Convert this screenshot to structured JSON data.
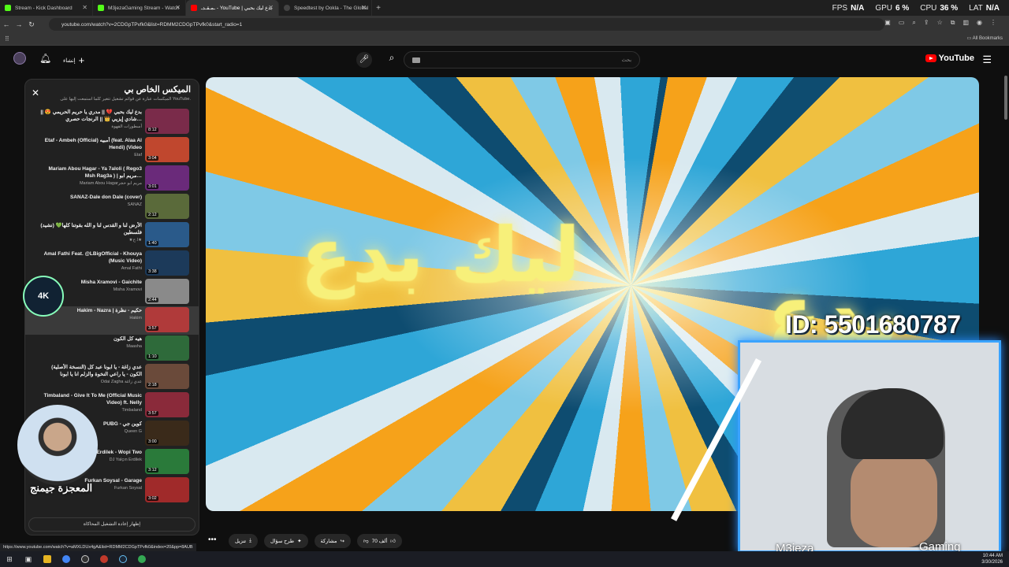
{
  "browser": {
    "tabs": [
      {
        "label": "Stream - Kick Dashboard",
        "color": "#53fc18",
        "active": false
      },
      {
        "label": "M3jezaGaming Stream - Watch",
        "color": "#53fc18",
        "active": false
      },
      {
        "label": "ـمـقـدـ - YouTube | بدع ليك بحبي",
        "color": "#ff0000",
        "active": true
      },
      {
        "label": "Speedtest by Ookla - The Global",
        "color": "#888888",
        "active": false
      }
    ],
    "url": "youtube.com/watch?v=2CDGpTPvfk0&list=RDMM2CDGpTPvfk0&start_radio=1",
    "all_bookmarks": "All Bookmarks",
    "status_url": "https://www.youtube.com/watch?v=aMXLDUx4gA&list=RDMM2CDGpTPvfk0&index=20&pp=8AUB"
  },
  "perf": {
    "fps_label": "FPS",
    "fps_value": "N/A",
    "gpu_label": "GPU",
    "gpu_value": "6 %",
    "cpu_label": "CPU",
    "cpu_value": "36 %",
    "lat_label": "LAT",
    "lat_value": "N/A"
  },
  "youtube": {
    "logo_text": "YouTube",
    "search_placeholder": "بحث",
    "create_label": "إنشاء"
  },
  "panel": {
    "title": "الميكس الخاص بي",
    "subtitle": "الميكسات عبارة عن قوائم تشغيل تتغير كلما استمعت إليها على YouTube.",
    "footer": "إظهار إعادة التشغيل المحاكاة",
    "items": [
      {
        "title": "بدع ليك بحبي 💔 || مدري يا حريم الحريمي 😍 || شادي إيزيي 👑 || الرنجات حصري…",
        "channel": "أسطورات القهوة",
        "duration": "8:12",
        "thumb": "#7a2b4a"
      },
      {
        "title": "Etaf - Ambeh (Official) أمبيه (feat. Alaa Al Hendi) (Video",
        "channel": "Etaf",
        "duration": "3:04",
        "thumb": "#c0472e"
      },
      {
        "title": "Mariam Abou Hagar - Ya 7aloli ( Rego3 Msh Rag3a ) | مريم ابو…",
        "channel": "Mariam Abou Hagarمريم ابو حجر",
        "duration": "3:01",
        "thumb": "#6a2a7a"
      },
      {
        "title": "SANAZ-Dale don Dale (cover)",
        "channel": "SANAZ",
        "duration": "2:12",
        "thumb": "#5a6a3a"
      },
      {
        "title": "(نشيد) الأرض لنا و القدس لنا و الله بقوتنا كلها💚فلسطين",
        "channel": "★ا.ح★",
        "duration": "1:40",
        "thumb": "#2a5a8a"
      },
      {
        "title": "Amal Fathi Feat. @LBigOfficial - Khouya (Music Video)",
        "channel": "Amal Fathi",
        "duration": "3:38",
        "thumb": "#1c3a5a"
      },
      {
        "title": "Misha Xramovi - Gaichite",
        "channel": "Misha Xramovi",
        "duration": "2:44",
        "thumb": "#8a8a8a"
      },
      {
        "title": "Hakim - Nazra | حكيم - نظرة",
        "channel": "Hakim",
        "duration": "3:57",
        "thumb": "#b03a3a"
      },
      {
        "title": "هيه كل الكون",
        "channel": "Maasha",
        "duration": "1:10",
        "thumb": "#2e6a3a"
      },
      {
        "title": "(النسخة الأصلية) عدي زاغة - يا ابونا عبد كل الكون - يا راعي النخوة والزلم انا يا ابونا",
        "channel": "Odai Zagha عدي زاغة",
        "duration": "2:18",
        "thumb": "#6a4a3a"
      },
      {
        "title": "Timbaland - Give It To Me (Official Music Video) ft. Nelly",
        "channel": "Timbaland",
        "duration": "3:57",
        "thumb": "#8a2a3a"
      },
      {
        "title": "PUBG - كوين جي",
        "channel": "Queen G",
        "duration": "3:00",
        "thumb": "#3a2a1a"
      },
      {
        "title": "Erdilek - Wopi Two",
        "channel": "DJ Yalçın Erdilek",
        "duration": "3:12",
        "thumb": "#2a7a3a"
      },
      {
        "title": "Furkan Soysal - Garage",
        "channel": "Furkan Soysal",
        "duration": "3:02",
        "thumb": "#a02a2a"
      }
    ]
  },
  "actions": {
    "likes": "70 ألف",
    "share": "مشاركة",
    "ask": "طرح سؤال",
    "download": "تنزيل"
  },
  "stream_overlay": {
    "id_text": "ID: 5501680787",
    "logo_text": "4K",
    "streamer_name": "المعجزة جيمنج",
    "cam_left": "M3jeza",
    "cam_right": "Gaming"
  },
  "video_art": {
    "main": "ليك بدع",
    "right": "بدع"
  },
  "clock": {
    "time": "10:44 AM",
    "date": "3/30/2026"
  }
}
